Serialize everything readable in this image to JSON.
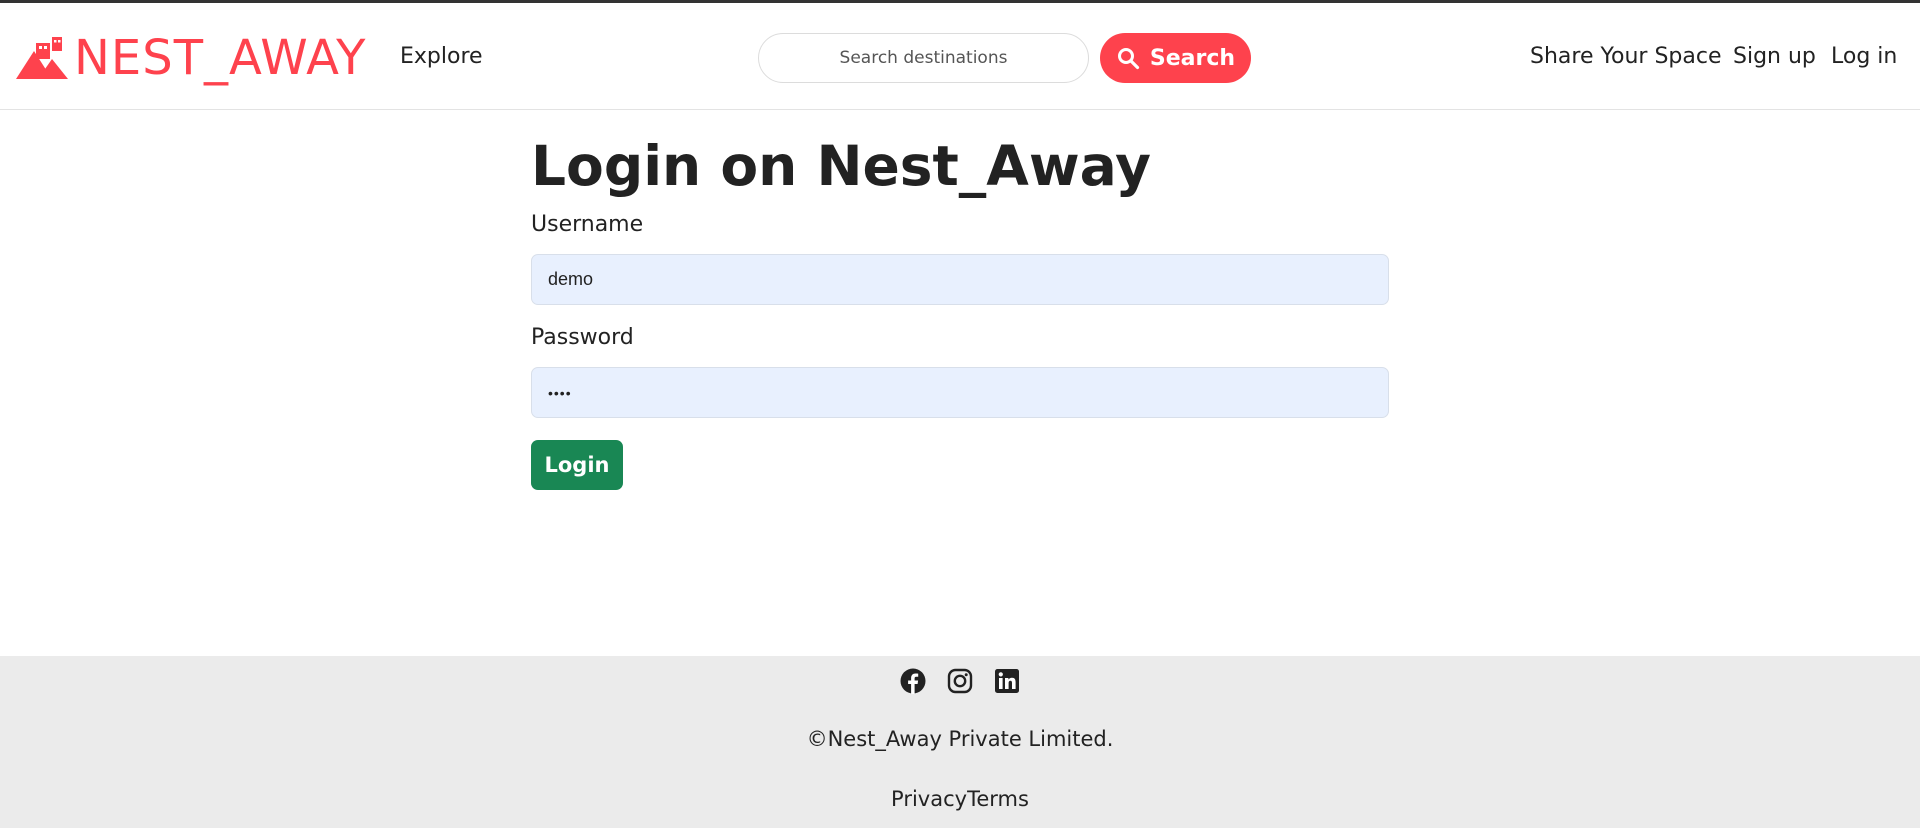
{
  "header": {
    "brand_name": "NEST_AWAY",
    "brand_color": "#fe424d",
    "brand_icon": "house-mountain-logo-icon",
    "nav_left": {
      "explore_label": "Explore"
    },
    "search": {
      "placeholder": "Search destinations",
      "button_label": "Search",
      "button_icon": "search-icon",
      "button_color": "#fe424d"
    },
    "nav_right": {
      "share_label": "Share Your Space",
      "signup_label": "Sign up",
      "login_label": "Log in"
    }
  },
  "main": {
    "title": "Login on Nest_Away",
    "username": {
      "label": "Username",
      "value": "demo"
    },
    "password": {
      "label": "Password",
      "value": "••••"
    },
    "submit_label": "Login",
    "submit_color": "#198754"
  },
  "footer": {
    "social_icons": [
      "facebook-icon",
      "instagram-icon",
      "linkedin-icon"
    ],
    "copyright": "©Nest_Away Private Limited.",
    "privacy_label": "Privacy",
    "terms_label": "Terms",
    "background": "#ebebeb"
  }
}
